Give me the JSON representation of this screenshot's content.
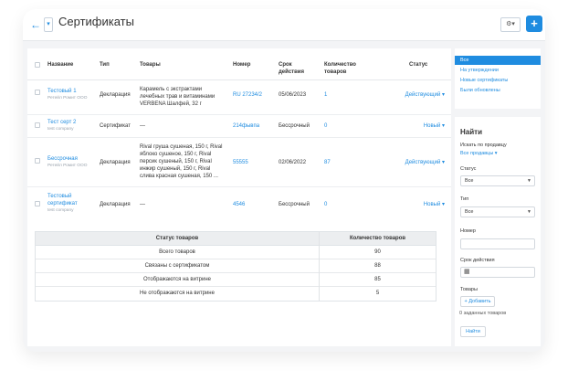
{
  "header": {
    "back_icon": "←",
    "dropdown_icon": "▾",
    "title": "Сертификаты",
    "settings_icon": "⚙▾",
    "add_icon": "+"
  },
  "table": {
    "columns": {
      "name": "Название",
      "type": "Тип",
      "goods": "Товары",
      "number": "Номер",
      "validity_line1": "Срок",
      "validity_line2": "действия",
      "qty_line1": "Количество",
      "qty_line2": "товаров",
      "status": "Статус"
    },
    "rows": [
      {
        "name_line1": "Тестовый 1",
        "name_line2": "",
        "company": "Ретейл Ромит ООО",
        "type": "Декларация",
        "goods_lines": [
          "Карамель с экстрактами",
          "лечебных трав и витаминами",
          "VERBENA Шалфей, 32 г"
        ],
        "number": "RU 27234/2",
        "validity": "05/06/2023",
        "qty": "1",
        "status": "Действующий ▾"
      },
      {
        "name_line1": "Тест серт 2",
        "name_line2": "",
        "company": "test company",
        "type": "Сертификат",
        "goods_lines": [
          "—"
        ],
        "number": "214фывпа",
        "validity": "Бессрочный",
        "qty": "0",
        "status": "Новый ▾"
      },
      {
        "name_line1": "Бессрочная",
        "name_line2": "",
        "company": "Ретейл Ромит ООО",
        "type": "Декларация",
        "goods_lines": [
          "Rival груша сушеная, 150 г, Rival",
          "яблоко сушеное, 150 г, Rival",
          "персик сушеный, 150 г, Rival",
          "инжир сушеный, 150 г, Rival",
          "слива красная сушеная, 150 ..."
        ],
        "number": "55555",
        "validity": "02/06/2022",
        "qty": "87",
        "status": "Действующий ▾"
      },
      {
        "name_line1": "Тестовый",
        "name_line2": "сертификат",
        "company": "test company",
        "type": "Декларация",
        "goods_lines": [
          "—"
        ],
        "number": "4546",
        "validity": "Бессрочный",
        "qty": "0",
        "status": "Новый ▾"
      }
    ]
  },
  "summary": {
    "head_status": "Статус товаров",
    "head_count": "Количество товаров",
    "rows": [
      {
        "label": "Всего товаров",
        "value": "90"
      },
      {
        "label": "Связаны с сертификатом",
        "value": "88"
      },
      {
        "label": "Отображаются на витрине",
        "value": "85"
      },
      {
        "label": "Не отображаются на витрине",
        "value": "5"
      }
    ]
  },
  "sidebar": {
    "filters": [
      "Все",
      "На утверждении",
      "Новые сертификаты",
      "Были обновлены"
    ],
    "find": {
      "title": "Найти",
      "seller_label": "Искать по продавцу",
      "seller_value": "Все продавцы ▾",
      "status_label": "Статус",
      "status_value": "Все",
      "type_label": "Тип",
      "type_value": "Все",
      "number_label": "Номер",
      "validity_label": "Срок действия",
      "calendar_icon": "▦",
      "goods_label": "Товары",
      "add_button": "+ Добавить",
      "selected_goods": "0 заданных товаров",
      "submit_button": "Найти"
    }
  }
}
